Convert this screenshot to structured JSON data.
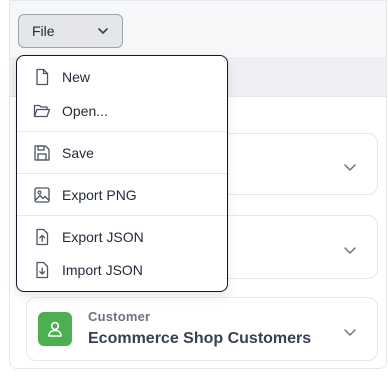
{
  "toolbar": {
    "file_label": "File"
  },
  "file_menu": {
    "items": [
      {
        "label": "New",
        "icon": "file-icon"
      },
      {
        "label": "Open...",
        "icon": "folder-open-icon"
      },
      {
        "label": "Save",
        "icon": "save-icon"
      },
      {
        "label": "Export PNG",
        "icon": "image-icon"
      },
      {
        "label": "Export JSON",
        "icon": "file-export-icon"
      },
      {
        "label": "Import JSON",
        "icon": "file-import-icon"
      }
    ]
  },
  "cards": [
    {
      "kicker": "Customer",
      "title": "Ecommerce Shop Customers",
      "icon": "user-icon",
      "icon_color": "#4caf50"
    }
  ],
  "colors": {
    "accent_green": "#4caf50",
    "menu_border": "#111827"
  }
}
